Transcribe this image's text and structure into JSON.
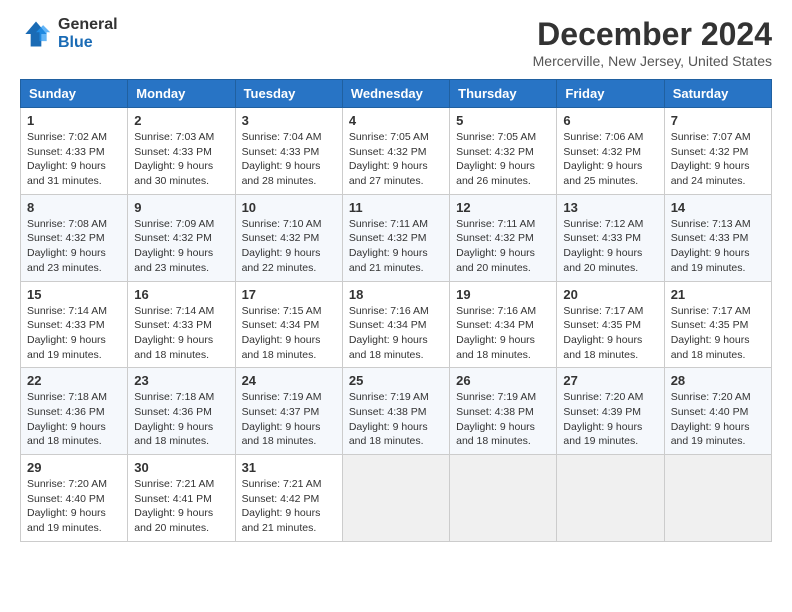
{
  "logo": {
    "general": "General",
    "blue": "Blue"
  },
  "title": "December 2024",
  "location": "Mercerville, New Jersey, United States",
  "days_of_week": [
    "Sunday",
    "Monday",
    "Tuesday",
    "Wednesday",
    "Thursday",
    "Friday",
    "Saturday"
  ],
  "weeks": [
    [
      {
        "day": "1",
        "sunrise": "7:02 AM",
        "sunset": "4:33 PM",
        "daylight": "9 hours and 31 minutes."
      },
      {
        "day": "2",
        "sunrise": "7:03 AM",
        "sunset": "4:33 PM",
        "daylight": "9 hours and 30 minutes."
      },
      {
        "day": "3",
        "sunrise": "7:04 AM",
        "sunset": "4:33 PM",
        "daylight": "9 hours and 28 minutes."
      },
      {
        "day": "4",
        "sunrise": "7:05 AM",
        "sunset": "4:32 PM",
        "daylight": "9 hours and 27 minutes."
      },
      {
        "day": "5",
        "sunrise": "7:05 AM",
        "sunset": "4:32 PM",
        "daylight": "9 hours and 26 minutes."
      },
      {
        "day": "6",
        "sunrise": "7:06 AM",
        "sunset": "4:32 PM",
        "daylight": "9 hours and 25 minutes."
      },
      {
        "day": "7",
        "sunrise": "7:07 AM",
        "sunset": "4:32 PM",
        "daylight": "9 hours and 24 minutes."
      }
    ],
    [
      {
        "day": "8",
        "sunrise": "7:08 AM",
        "sunset": "4:32 PM",
        "daylight": "9 hours and 23 minutes."
      },
      {
        "day": "9",
        "sunrise": "7:09 AM",
        "sunset": "4:32 PM",
        "daylight": "9 hours and 23 minutes."
      },
      {
        "day": "10",
        "sunrise": "7:10 AM",
        "sunset": "4:32 PM",
        "daylight": "9 hours and 22 minutes."
      },
      {
        "day": "11",
        "sunrise": "7:11 AM",
        "sunset": "4:32 PM",
        "daylight": "9 hours and 21 minutes."
      },
      {
        "day": "12",
        "sunrise": "7:11 AM",
        "sunset": "4:32 PM",
        "daylight": "9 hours and 20 minutes."
      },
      {
        "day": "13",
        "sunrise": "7:12 AM",
        "sunset": "4:33 PM",
        "daylight": "9 hours and 20 minutes."
      },
      {
        "day": "14",
        "sunrise": "7:13 AM",
        "sunset": "4:33 PM",
        "daylight": "9 hours and 19 minutes."
      }
    ],
    [
      {
        "day": "15",
        "sunrise": "7:14 AM",
        "sunset": "4:33 PM",
        "daylight": "9 hours and 19 minutes."
      },
      {
        "day": "16",
        "sunrise": "7:14 AM",
        "sunset": "4:33 PM",
        "daylight": "9 hours and 18 minutes."
      },
      {
        "day": "17",
        "sunrise": "7:15 AM",
        "sunset": "4:34 PM",
        "daylight": "9 hours and 18 minutes."
      },
      {
        "day": "18",
        "sunrise": "7:16 AM",
        "sunset": "4:34 PM",
        "daylight": "9 hours and 18 minutes."
      },
      {
        "day": "19",
        "sunrise": "7:16 AM",
        "sunset": "4:34 PM",
        "daylight": "9 hours and 18 minutes."
      },
      {
        "day": "20",
        "sunrise": "7:17 AM",
        "sunset": "4:35 PM",
        "daylight": "9 hours and 18 minutes."
      },
      {
        "day": "21",
        "sunrise": "7:17 AM",
        "sunset": "4:35 PM",
        "daylight": "9 hours and 18 minutes."
      }
    ],
    [
      {
        "day": "22",
        "sunrise": "7:18 AM",
        "sunset": "4:36 PM",
        "daylight": "9 hours and 18 minutes."
      },
      {
        "day": "23",
        "sunrise": "7:18 AM",
        "sunset": "4:36 PM",
        "daylight": "9 hours and 18 minutes."
      },
      {
        "day": "24",
        "sunrise": "7:19 AM",
        "sunset": "4:37 PM",
        "daylight": "9 hours and 18 minutes."
      },
      {
        "day": "25",
        "sunrise": "7:19 AM",
        "sunset": "4:38 PM",
        "daylight": "9 hours and 18 minutes."
      },
      {
        "day": "26",
        "sunrise": "7:19 AM",
        "sunset": "4:38 PM",
        "daylight": "9 hours and 18 minutes."
      },
      {
        "day": "27",
        "sunrise": "7:20 AM",
        "sunset": "4:39 PM",
        "daylight": "9 hours and 19 minutes."
      },
      {
        "day": "28",
        "sunrise": "7:20 AM",
        "sunset": "4:40 PM",
        "daylight": "9 hours and 19 minutes."
      }
    ],
    [
      {
        "day": "29",
        "sunrise": "7:20 AM",
        "sunset": "4:40 PM",
        "daylight": "9 hours and 19 minutes."
      },
      {
        "day": "30",
        "sunrise": "7:21 AM",
        "sunset": "4:41 PM",
        "daylight": "9 hours and 20 minutes."
      },
      {
        "day": "31",
        "sunrise": "7:21 AM",
        "sunset": "4:42 PM",
        "daylight": "9 hours and 21 minutes."
      },
      null,
      null,
      null,
      null
    ]
  ]
}
